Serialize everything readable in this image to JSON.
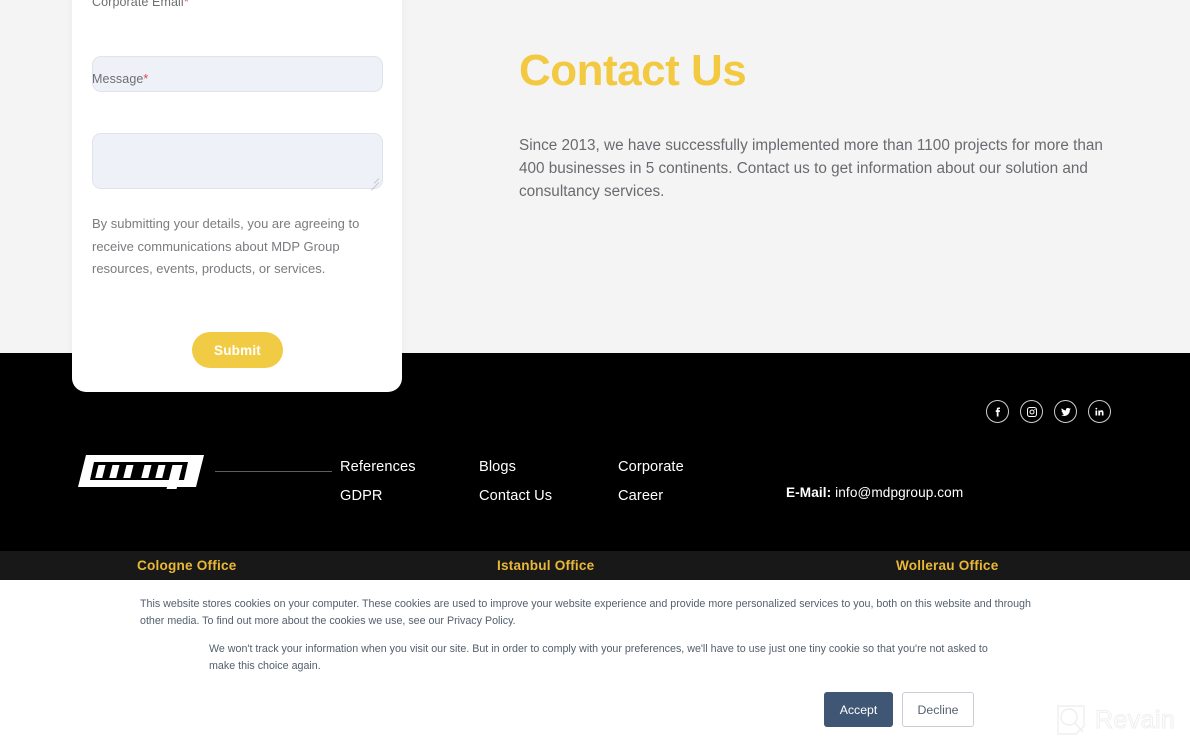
{
  "form": {
    "fields": [
      {
        "label": "",
        "required": false,
        "value": "",
        "type": "text"
      },
      {
        "label": "Corporate Email",
        "required": true,
        "value": "",
        "type": "email"
      },
      {
        "label": "Message",
        "required": true,
        "value": "",
        "type": "textarea"
      }
    ],
    "email_label": "Corporate Email",
    "message_label": "Message",
    "required_mark": "*",
    "consent_text": "By submitting your details, you are agreeing to receive communications about MDP Group resources, events, products, or services.",
    "submit_label": "Submit",
    "submit_color": "#f2cb45"
  },
  "hero": {
    "title": "Contact Us",
    "title_color": "#f2c940",
    "body": "Since 2013, we have successfully implemented more than 1100 projects for more than 400 businesses in 5 continents. Contact us to get information about our solution and consultancy services."
  },
  "footer": {
    "background": "#000000",
    "logo_alt": "mdp",
    "social": [
      {
        "name": "facebook-icon",
        "label": "Facebook"
      },
      {
        "name": "instagram-icon",
        "label": "Instagram"
      },
      {
        "name": "twitter-icon",
        "label": "Twitter"
      },
      {
        "name": "linkedin-icon",
        "label": "LinkedIn"
      }
    ],
    "link_columns": [
      {
        "links": [
          "References",
          "GDPR"
        ]
      },
      {
        "links": [
          "Blogs",
          "Contact Us"
        ]
      },
      {
        "links": [
          "Corporate",
          "Career"
        ]
      }
    ],
    "email_label": "E-Mail:",
    "email_value": "info@mdpgroup.com"
  },
  "offices": {
    "background": "#181818",
    "accent": "#e9b836",
    "items": [
      "Cologne Office",
      "Istanbul Office",
      "Wollerau Office"
    ]
  },
  "cookie": {
    "paragraph_1": "This website stores cookies on your computer. These cookies are used to improve your website experience and provide more personalized services to you, both on this website and through other media. To find out more about the cookies we use, see our Privacy Policy.",
    "paragraph_2": "We won't track your information when you visit our site. But in order to comply with your preferences, we'll have to use just one tiny cookie so that you're not asked to make this choice again.",
    "accept_label": "Accept",
    "decline_label": "Decline",
    "accept_color": "#3f5674"
  },
  "watermark": {
    "text": "Revain"
  }
}
